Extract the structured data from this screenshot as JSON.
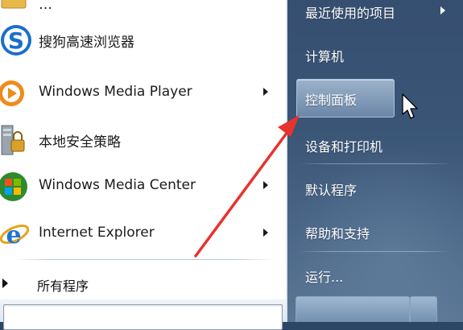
{
  "left_menu": {
    "items": [
      {
        "label": "…",
        "icon": "folder-icon"
      },
      {
        "label": "搜狗高速浏览器",
        "icon": "sogou-browser-icon"
      },
      {
        "label": "Windows Media Player",
        "icon": "media-player-icon",
        "has_submenu": true
      },
      {
        "label": "本地安全策略",
        "icon": "security-policy-icon"
      },
      {
        "label": "Windows Media Center",
        "icon": "media-center-icon",
        "has_submenu": true
      },
      {
        "label": "Internet Explorer",
        "icon": "internet-explorer-icon",
        "has_submenu": true
      }
    ],
    "all_programs_label": "所有程序"
  },
  "right_menu": {
    "items": [
      {
        "label": "最近使用的项目",
        "has_submenu": true
      },
      {
        "label": "计算机"
      },
      {
        "label": "控制面板",
        "highlighted": true
      },
      {
        "label": "设备和打印机"
      },
      {
        "label": "默认程序"
      },
      {
        "label": "帮助和支持"
      },
      {
        "label": "运行..."
      }
    ]
  },
  "colors": {
    "highlight": "#a9c1dc",
    "annotation_arrow": "#e8322c",
    "right_pane": "#3a5576"
  }
}
